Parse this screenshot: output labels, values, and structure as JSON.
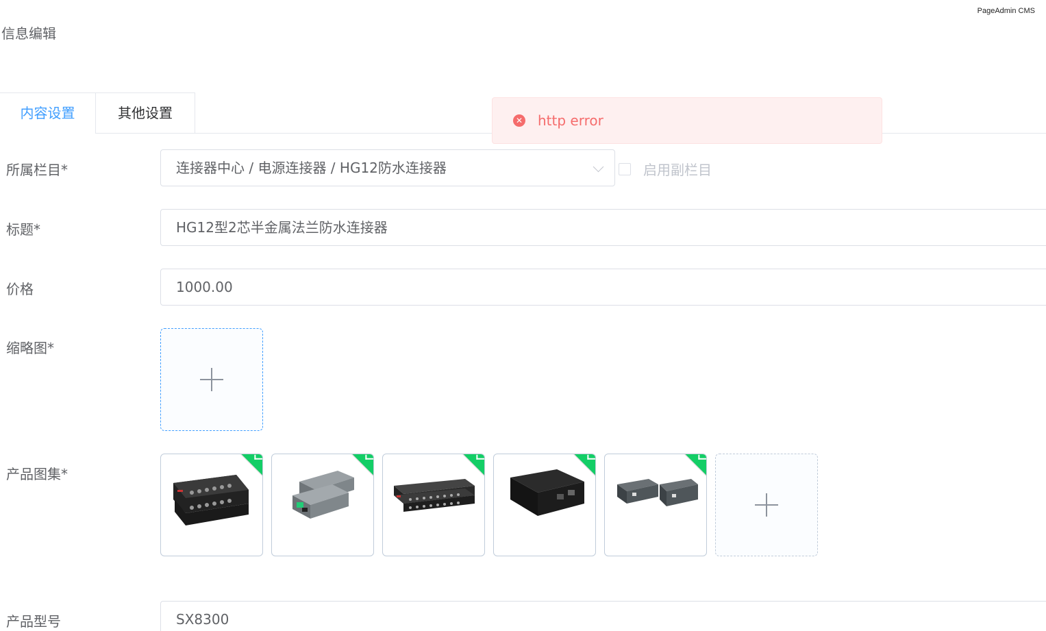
{
  "app": {
    "brand": "PageAdmin CMS",
    "page_title": "信息编辑"
  },
  "tabs": [
    {
      "label": "内容设置",
      "active": true
    },
    {
      "label": "其他设置",
      "active": false
    }
  ],
  "toast": {
    "type": "error",
    "message": "http error",
    "icon": "close-circle-icon",
    "color": "#f56c6c"
  },
  "form": {
    "category": {
      "label": "所属栏目*",
      "value": "连接器中心 / 电源连接器 / HG12防水连接器",
      "sub_category_label": "启用副栏目",
      "sub_category_checked": false
    },
    "title": {
      "label": "标题*",
      "value": "HG12型2芯半金属法兰防水连接器"
    },
    "price": {
      "label": "价格",
      "value": "1000.00"
    },
    "thumbnail": {
      "label": "缩略图*"
    },
    "gallery": {
      "label": "产品图集*",
      "items": [
        {
          "icon": "product-image",
          "status": "uploaded"
        },
        {
          "icon": "product-image",
          "status": "uploaded"
        },
        {
          "icon": "product-image",
          "status": "uploaded"
        },
        {
          "icon": "product-image",
          "status": "uploaded"
        },
        {
          "icon": "product-image",
          "status": "uploaded"
        }
      ]
    },
    "model": {
      "label": "产品型号",
      "value": "SX8300"
    }
  },
  "colors": {
    "accent": "#409eff",
    "success": "#13ce66",
    "error": "#f56c6c"
  }
}
